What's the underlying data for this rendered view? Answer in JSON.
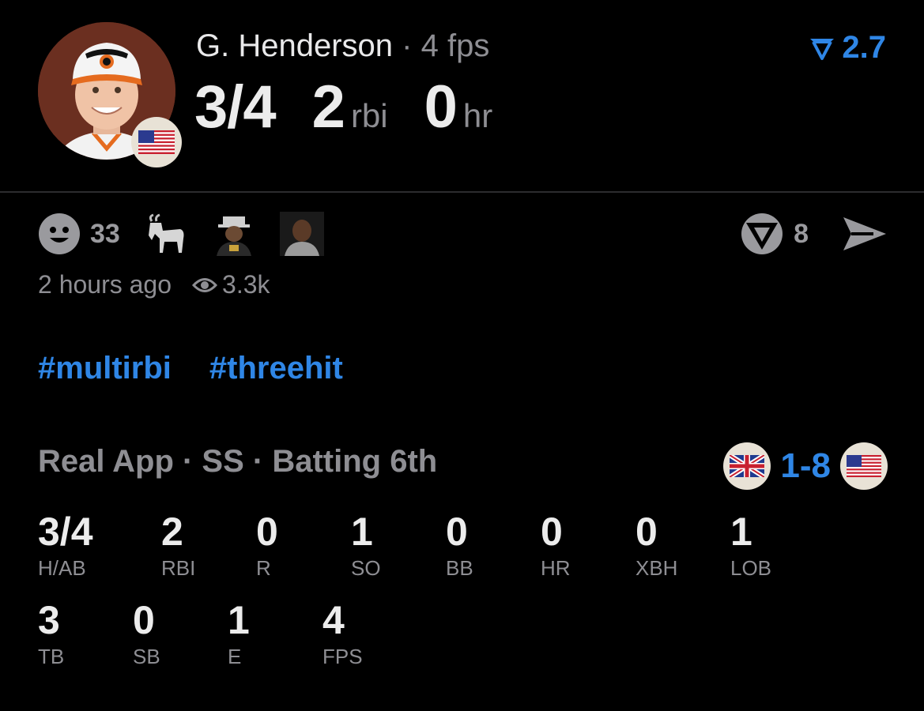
{
  "player": {
    "name": "G. Henderson",
    "separator": "·",
    "fps_label": "4 fps"
  },
  "headline": {
    "hits": "3/4",
    "rbi_value": "2",
    "rbi_unit": "rbi",
    "hr_value": "0",
    "hr_unit": "hr"
  },
  "rating": {
    "icon": "filter-funnel-icon",
    "value": "2.7"
  },
  "reactions": {
    "smile_count": "33",
    "emojis": [
      "goat-emoji",
      "reaction-sticker-1",
      "reaction-sticker-2"
    ]
  },
  "actions": {
    "comment_count": "8",
    "share_icon": "send-icon"
  },
  "meta": {
    "time_ago": "2 hours ago",
    "views": "3.3k"
  },
  "tags": [
    "#multirbi",
    "#threehit"
  ],
  "game": {
    "line": "Real App · SS · Batting 6th",
    "score": "1-8",
    "away_flag": "uk-flag-icon",
    "home_flag": "us-flag-icon"
  },
  "stats_row1": [
    {
      "value": "3/4",
      "label": "H/AB"
    },
    {
      "value": "2",
      "label": "RBI"
    },
    {
      "value": "0",
      "label": "R"
    },
    {
      "value": "1",
      "label": "SO"
    },
    {
      "value": "0",
      "label": "BB"
    },
    {
      "value": "0",
      "label": "HR"
    },
    {
      "value": "0",
      "label": "XBH"
    },
    {
      "value": "1",
      "label": "LOB"
    }
  ],
  "stats_row2": [
    {
      "value": "3",
      "label": "TB"
    },
    {
      "value": "0",
      "label": "SB"
    },
    {
      "value": "1",
      "label": "E"
    },
    {
      "value": "4",
      "label": "FPS"
    }
  ],
  "colors": {
    "accent": "#2f86e6",
    "muted": "#8e8e93",
    "background": "#000000"
  }
}
